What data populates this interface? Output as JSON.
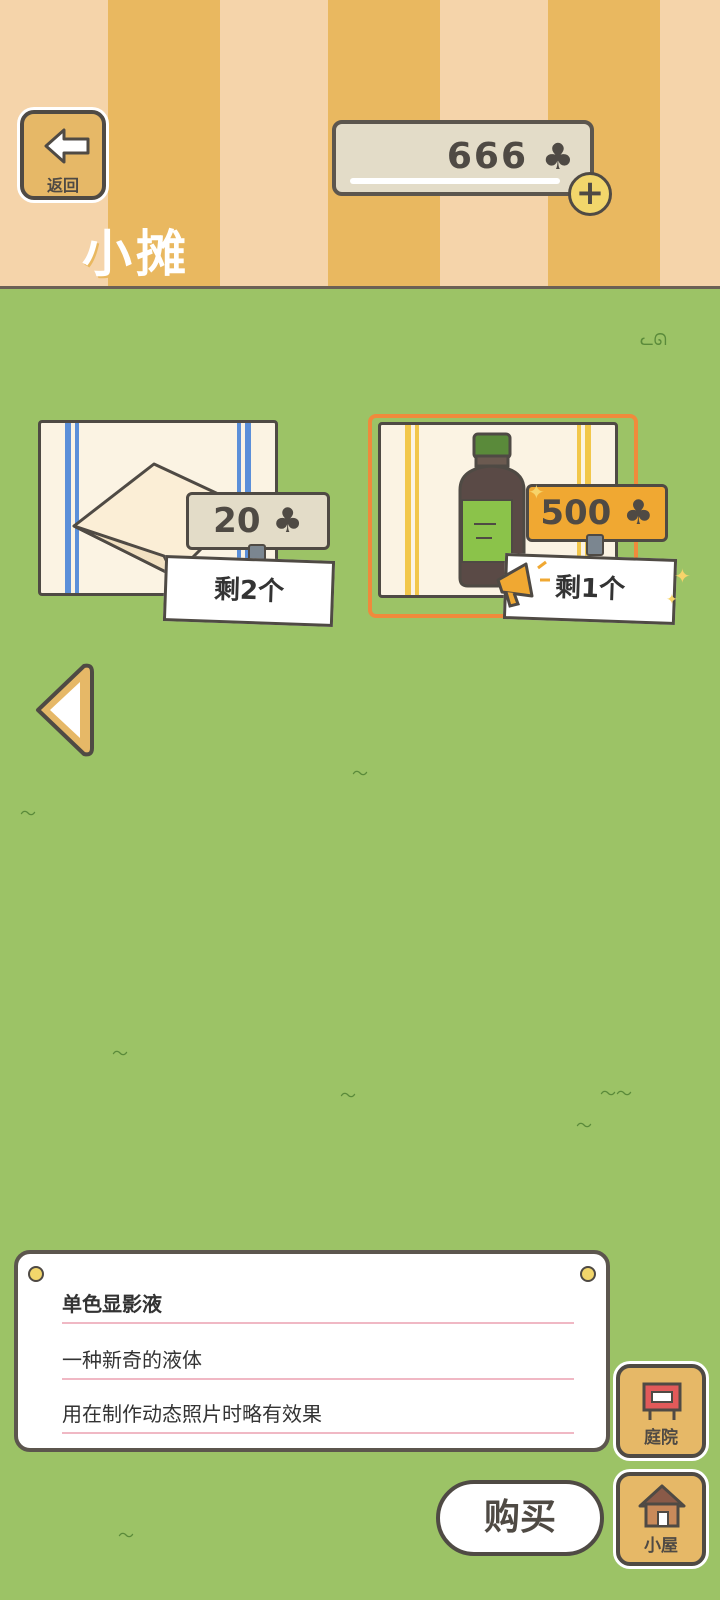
{
  "header": {
    "back_label": "返回",
    "title": "小摊",
    "currency_value": "666",
    "currency_icon": "clover-icon"
  },
  "items": [
    {
      "price": "20",
      "price_color": "#e3dcc8",
      "remaining": "剩2个"
    },
    {
      "price": "500",
      "price_color": "#f0a832",
      "remaining": "剩1个"
    }
  ],
  "description": {
    "name": "单色显影液",
    "line1": "一种新奇的液体",
    "line2": "用在制作动态照片时略有效果"
  },
  "side_nav": {
    "yard_label": "庭院",
    "house_label": "小屋"
  },
  "buy_label": "购买"
}
